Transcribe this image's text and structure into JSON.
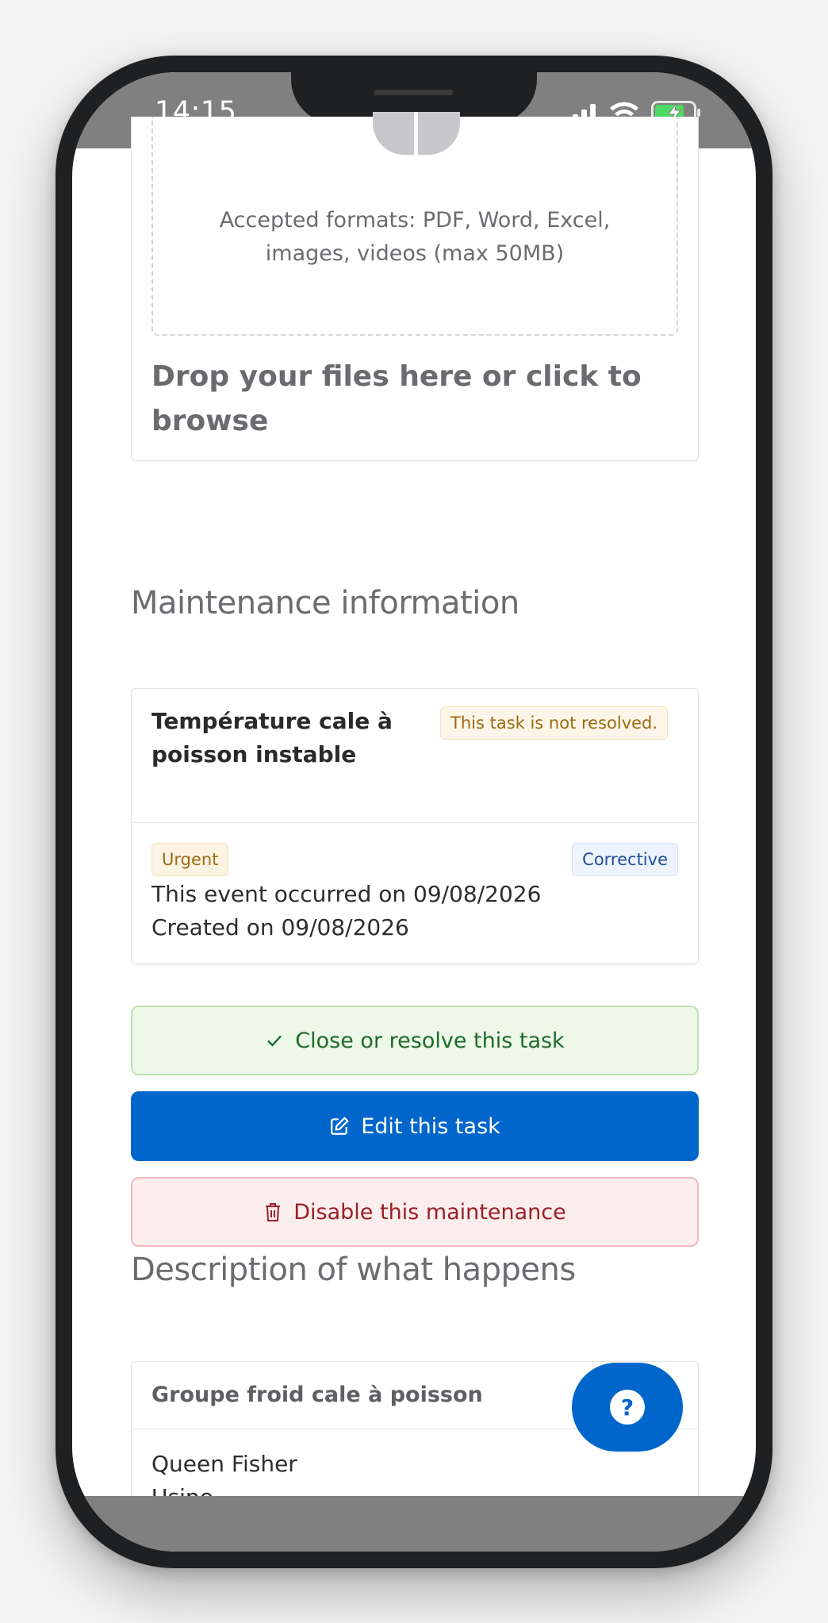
{
  "status_bar": {
    "time": "14:15",
    "icons": [
      "cellular-signal-icon",
      "wifi-icon",
      "battery-charging-icon"
    ]
  },
  "upload": {
    "formats_line1": "Accepted formats: PDF, Word, Excel,",
    "formats_line2": "images, videos (max 50MB)",
    "drop_text": "Drop your files here or click to browse"
  },
  "maintenance": {
    "section_title": "Maintenance information",
    "task_title": "Température cale à poisson instable",
    "status_badge": "This task is not resolved.",
    "priority_badge": "Urgent",
    "type_badge": "Corrective",
    "occurred_text": "This event occurred on 09/08/2026",
    "created_text": "Created on 09/08/2026"
  },
  "actions": {
    "resolve_label": "Close or resolve this task",
    "edit_label": "Edit this task",
    "disable_label": "Disable this maintenance"
  },
  "description": {
    "section_title": "Description of what happens",
    "equipment": "Groupe froid cale à poisson",
    "vessel": "Queen Fisher",
    "location": "Usine"
  },
  "help": {
    "label": "?"
  },
  "colors": {
    "primary": "#0066cc",
    "success_bg": "#eef8e9",
    "success_text": "#1e6a2b",
    "danger_bg": "#fdeeee",
    "danger_text": "#9b1f25",
    "warning_text": "#9a6a12"
  }
}
